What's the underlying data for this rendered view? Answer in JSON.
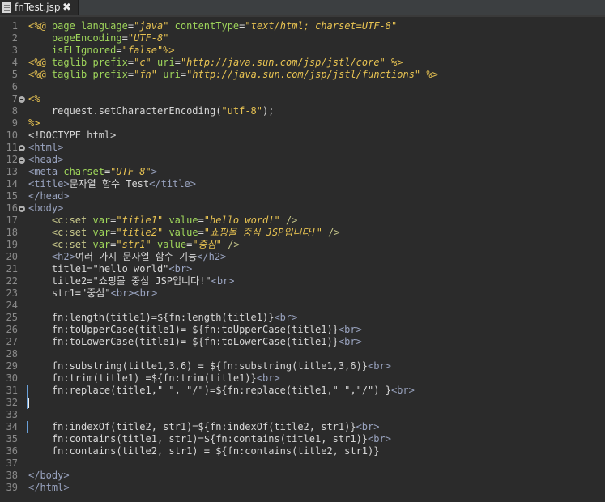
{
  "tab": {
    "label": "fnTest.jsp",
    "close": "✖",
    "icon": "jsp-file-icon"
  },
  "editor": {
    "lines": [
      {
        "n": "1",
        "fold": false,
        "marker": false,
        "caret": false,
        "tokens": [
          [
            "pd",
            "<%@ "
          ],
          [
            "at",
            "page"
          ],
          [
            "txt",
            " "
          ],
          [
            "at",
            "language"
          ],
          [
            "txt",
            "="
          ],
          [
            "str",
            "\"java\""
          ],
          [
            "txt",
            " "
          ],
          [
            "at",
            "contentType"
          ],
          [
            "txt",
            "="
          ],
          [
            "str",
            "\"text/html; charset=UTF-8\""
          ]
        ]
      },
      {
        "n": "2",
        "fold": false,
        "marker": false,
        "caret": false,
        "tokens": [
          [
            "txt",
            "    "
          ],
          [
            "at",
            "pageEncoding"
          ],
          [
            "txt",
            "="
          ],
          [
            "str",
            "\"UTF-8\""
          ]
        ]
      },
      {
        "n": "3",
        "fold": false,
        "marker": false,
        "caret": false,
        "tokens": [
          [
            "txt",
            "    "
          ],
          [
            "at",
            "isELIgnored"
          ],
          [
            "txt",
            "="
          ],
          [
            "str",
            "\"false\""
          ],
          [
            "pd",
            "%>"
          ]
        ]
      },
      {
        "n": "4",
        "fold": false,
        "marker": false,
        "caret": false,
        "tokens": [
          [
            "pd",
            "<%@ "
          ],
          [
            "at",
            "taglib"
          ],
          [
            "txt",
            " "
          ],
          [
            "at",
            "prefix"
          ],
          [
            "txt",
            "="
          ],
          [
            "str",
            "\"c\""
          ],
          [
            "txt",
            " "
          ],
          [
            "at",
            "uri"
          ],
          [
            "txt",
            "="
          ],
          [
            "str",
            "\"http://java.sun.com/jsp/jstl/core\""
          ],
          [
            "txt",
            " "
          ],
          [
            "pd",
            "%>"
          ]
        ]
      },
      {
        "n": "5",
        "fold": false,
        "marker": false,
        "caret": false,
        "tokens": [
          [
            "pd",
            "<%@ "
          ],
          [
            "at",
            "taglib"
          ],
          [
            "txt",
            " "
          ],
          [
            "at",
            "prefix"
          ],
          [
            "txt",
            "="
          ],
          [
            "str",
            "\"fn\""
          ],
          [
            "txt",
            " "
          ],
          [
            "at",
            "uri"
          ],
          [
            "txt",
            "="
          ],
          [
            "str",
            "\"http://java.sun.com/jsp/jstl/functions\""
          ],
          [
            "txt",
            " "
          ],
          [
            "pd",
            "%>"
          ]
        ]
      },
      {
        "n": "6",
        "fold": false,
        "marker": false,
        "caret": false,
        "tokens": []
      },
      {
        "n": "7",
        "fold": true,
        "marker": false,
        "caret": false,
        "tokens": [
          [
            "pd",
            "<%"
          ]
        ]
      },
      {
        "n": "8",
        "fold": false,
        "marker": false,
        "caret": false,
        "tokens": [
          [
            "txt",
            "    request.setCharacterEncoding("
          ],
          [
            "strn",
            "\"utf-8\""
          ],
          [
            "txt",
            ");"
          ]
        ]
      },
      {
        "n": "9",
        "fold": false,
        "marker": false,
        "caret": false,
        "tokens": [
          [
            "pd",
            "%>"
          ]
        ]
      },
      {
        "n": "10",
        "fold": false,
        "marker": false,
        "caret": false,
        "tokens": [
          [
            "doc",
            "<!DOCTYPE html>"
          ]
        ]
      },
      {
        "n": "11",
        "fold": true,
        "marker": false,
        "caret": false,
        "tokens": [
          [
            "tag",
            "<html>"
          ]
        ]
      },
      {
        "n": "12",
        "fold": true,
        "marker": false,
        "caret": false,
        "tokens": [
          [
            "tag",
            "<head>"
          ]
        ]
      },
      {
        "n": "13",
        "fold": false,
        "marker": false,
        "caret": false,
        "tokens": [
          [
            "tag",
            "<meta "
          ],
          [
            "at",
            "charset"
          ],
          [
            "txt",
            "="
          ],
          [
            "str",
            "\"UTF-8\""
          ],
          [
            "tag",
            ">"
          ]
        ]
      },
      {
        "n": "14",
        "fold": false,
        "marker": false,
        "caret": false,
        "tokens": [
          [
            "tag",
            "<title>"
          ],
          [
            "txt",
            "문자열 함수 Test"
          ],
          [
            "tag",
            "</title>"
          ]
        ]
      },
      {
        "n": "15",
        "fold": false,
        "marker": false,
        "caret": false,
        "tokens": [
          [
            "tag",
            "</head>"
          ]
        ]
      },
      {
        "n": "16",
        "fold": true,
        "marker": false,
        "caret": false,
        "tokens": [
          [
            "tag",
            "<body>"
          ]
        ]
      },
      {
        "n": "17",
        "fold": false,
        "marker": false,
        "caret": false,
        "tokens": [
          [
            "txt",
            "    "
          ],
          [
            "jstl",
            "<c:set "
          ],
          [
            "at",
            "var"
          ],
          [
            "txt",
            "="
          ],
          [
            "str",
            "\"title1\""
          ],
          [
            "txt",
            " "
          ],
          [
            "at",
            "value"
          ],
          [
            "txt",
            "="
          ],
          [
            "str",
            "\"hello word!\""
          ],
          [
            "txt",
            " "
          ],
          [
            "jstl",
            "/>"
          ]
        ]
      },
      {
        "n": "18",
        "fold": false,
        "marker": false,
        "caret": false,
        "tokens": [
          [
            "txt",
            "    "
          ],
          [
            "jstl",
            "<c:set "
          ],
          [
            "at",
            "var"
          ],
          [
            "txt",
            "="
          ],
          [
            "str",
            "\"title2\""
          ],
          [
            "txt",
            " "
          ],
          [
            "at",
            "value"
          ],
          [
            "txt",
            "="
          ],
          [
            "str",
            "\"쇼핑몰 중심 JSP입니다!\""
          ],
          [
            "txt",
            " "
          ],
          [
            "jstl",
            "/>"
          ]
        ]
      },
      {
        "n": "19",
        "fold": false,
        "marker": false,
        "caret": false,
        "tokens": [
          [
            "txt",
            "    "
          ],
          [
            "jstl",
            "<c:set "
          ],
          [
            "at",
            "var"
          ],
          [
            "txt",
            "="
          ],
          [
            "str",
            "\"str1\""
          ],
          [
            "txt",
            " "
          ],
          [
            "at",
            "value"
          ],
          [
            "txt",
            "="
          ],
          [
            "str",
            "\"중심\""
          ],
          [
            "txt",
            " "
          ],
          [
            "jstl",
            "/>"
          ]
        ]
      },
      {
        "n": "20",
        "fold": false,
        "marker": false,
        "caret": false,
        "tokens": [
          [
            "txt",
            "    "
          ],
          [
            "tag",
            "<h2>"
          ],
          [
            "txt",
            "여러 가지 문자열 함수 기능"
          ],
          [
            "tag",
            "</h2>"
          ]
        ]
      },
      {
        "n": "21",
        "fold": false,
        "marker": false,
        "caret": false,
        "tokens": [
          [
            "txt",
            "    title1=\"hello world\""
          ],
          [
            "tag",
            "<br>"
          ]
        ]
      },
      {
        "n": "22",
        "fold": false,
        "marker": false,
        "caret": false,
        "tokens": [
          [
            "txt",
            "    title2=\"쇼핑몰 중심 JSP입니다!\""
          ],
          [
            "tag",
            "<br>"
          ]
        ]
      },
      {
        "n": "23",
        "fold": false,
        "marker": false,
        "caret": false,
        "tokens": [
          [
            "txt",
            "    str1=\"중심\""
          ],
          [
            "tag",
            "<br><br>"
          ]
        ]
      },
      {
        "n": "24",
        "fold": false,
        "marker": false,
        "caret": false,
        "tokens": []
      },
      {
        "n": "25",
        "fold": false,
        "marker": false,
        "caret": false,
        "tokens": [
          [
            "txt",
            "    fn:length(title1)=${fn:length(title1)}"
          ],
          [
            "tag",
            "<br>"
          ]
        ]
      },
      {
        "n": "26",
        "fold": false,
        "marker": false,
        "caret": false,
        "tokens": [
          [
            "txt",
            "    fn:toUpperCase(title1)= ${fn:toUpperCase(title1)}"
          ],
          [
            "tag",
            "<br>"
          ]
        ]
      },
      {
        "n": "27",
        "fold": false,
        "marker": false,
        "caret": false,
        "tokens": [
          [
            "txt",
            "    fn:toLowerCase(title1)= ${fn:toLowerCase(title1)}"
          ],
          [
            "tag",
            "<br>"
          ]
        ]
      },
      {
        "n": "28",
        "fold": false,
        "marker": false,
        "caret": false,
        "tokens": []
      },
      {
        "n": "29",
        "fold": false,
        "marker": false,
        "caret": false,
        "tokens": [
          [
            "txt",
            "    fn:substring(title1,3,6) = ${fn:substring(title1,3,6)}"
          ],
          [
            "tag",
            "<br>"
          ]
        ]
      },
      {
        "n": "30",
        "fold": false,
        "marker": false,
        "caret": false,
        "tokens": [
          [
            "txt",
            "    fn:trim(title1) =${fn:trim(title1)}"
          ],
          [
            "tag",
            "<br>"
          ]
        ]
      },
      {
        "n": "31",
        "fold": false,
        "marker": true,
        "caret": false,
        "tokens": [
          [
            "txt",
            "    fn:replace(title1,\" \", \"/\")=${fn:replace(title1,\" \",\"/\") }"
          ],
          [
            "tag",
            "<br>"
          ]
        ]
      },
      {
        "n": "32",
        "fold": false,
        "marker": true,
        "caret": true,
        "tokens": []
      },
      {
        "n": "33",
        "fold": false,
        "marker": false,
        "caret": false,
        "tokens": []
      },
      {
        "n": "34",
        "fold": false,
        "marker": true,
        "caret": false,
        "tokens": [
          [
            "txt",
            "    fn:indexOf(title2, str1)=${fn:indexOf(title2, str1)}"
          ],
          [
            "tag",
            "<br>"
          ]
        ]
      },
      {
        "n": "35",
        "fold": false,
        "marker": false,
        "caret": false,
        "tokens": [
          [
            "txt",
            "    fn:contains(title1, str1)=${fn:contains(title1, str1)}"
          ],
          [
            "tag",
            "<br>"
          ]
        ]
      },
      {
        "n": "36",
        "fold": false,
        "marker": false,
        "caret": false,
        "tokens": [
          [
            "txt",
            "    fn:contains(title2, str1) = ${fn:contains(title2, str1)}"
          ]
        ]
      },
      {
        "n": "37",
        "fold": false,
        "marker": false,
        "caret": false,
        "tokens": []
      },
      {
        "n": "38",
        "fold": false,
        "marker": false,
        "caret": false,
        "tokens": [
          [
            "tag",
            "</body>"
          ]
        ]
      },
      {
        "n": "39",
        "fold": false,
        "marker": false,
        "caret": false,
        "tokens": [
          [
            "tag",
            "</html>"
          ]
        ]
      }
    ]
  }
}
